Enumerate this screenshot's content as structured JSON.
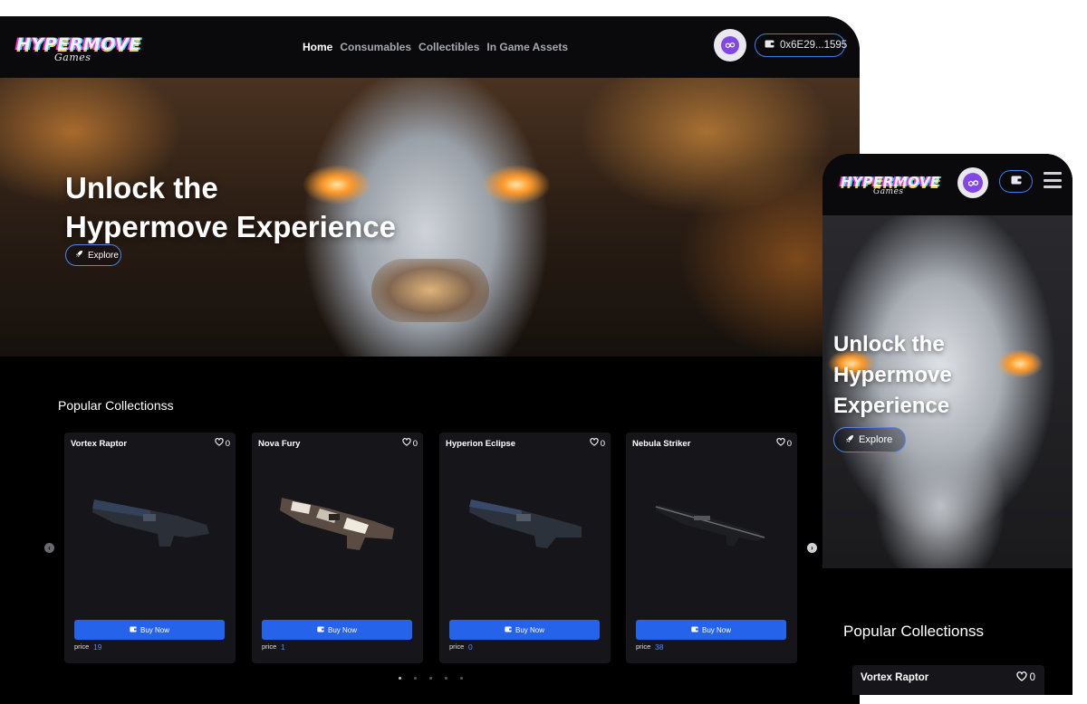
{
  "brand": {
    "logo_main": "HYPERMOVE",
    "logo_sub": "Games"
  },
  "nav": {
    "links": [
      {
        "label": "Home",
        "active": true
      },
      {
        "label": "Consumables",
        "active": false
      },
      {
        "label": "Collectibles",
        "active": false
      },
      {
        "label": "In Game Assets",
        "active": false
      }
    ],
    "wallet_address": "0x6E29...1595",
    "chain_icon": "polygon-icon",
    "wallet_icon": "wallet-icon"
  },
  "hero": {
    "title_line1": "Unlock the",
    "title_line2": "Hypermove Experience",
    "explore_label": "Explore",
    "explore_icon": "rocket-icon"
  },
  "collections": {
    "title": "Popular Collectionss",
    "buy_label": "Buy Now",
    "price_label": "price",
    "items": [
      {
        "name": "Vortex Raptor",
        "likes": "0",
        "price": "19"
      },
      {
        "name": "Nova Fury",
        "likes": "0",
        "price": "1"
      },
      {
        "name": "Hyperion Eclipse",
        "likes": "0",
        "price": "0"
      },
      {
        "name": "Nebula Striker",
        "likes": "0",
        "price": "38"
      }
    ],
    "pagination_pages": 5,
    "active_page": 1
  },
  "mobile": {
    "hero_line1": "Unlock the",
    "hero_line2": "Hypermove",
    "hero_line3": "Experience",
    "explore_label": "Explore",
    "section_title": "Popular Collectionss",
    "first_item_name": "Vortex Raptor",
    "first_item_likes": "0"
  },
  "colors": {
    "accent": "#2563eb",
    "price": "#4f8cff",
    "polygon": "#8247e5"
  }
}
